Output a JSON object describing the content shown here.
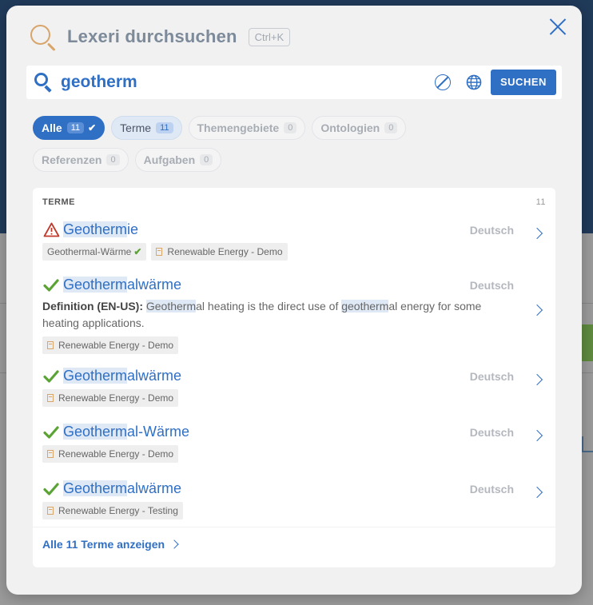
{
  "modal": {
    "title": "Lexeri durchsuchen",
    "shortcut": "Ctrl+K"
  },
  "search": {
    "query": "geotherm",
    "button_label": "SUCHEN"
  },
  "filters": [
    {
      "label": "Alle",
      "count": "11",
      "state": "active"
    },
    {
      "label": "Terme",
      "count": "11",
      "state": "selected"
    },
    {
      "label": "Themengebiete",
      "count": "0",
      "state": "default"
    },
    {
      "label": "Ontologien",
      "count": "0",
      "state": "default"
    },
    {
      "label": "Referenzen",
      "count": "0",
      "state": "default"
    },
    {
      "label": "Aufgaben",
      "count": "0",
      "state": "default"
    }
  ],
  "results": {
    "section_label": "TERME",
    "total": "11",
    "items": [
      {
        "status_icon": "warning-icon",
        "title_highlight": "Geotherm",
        "title_rest": "ie",
        "language": "Deutsch",
        "tags": [
          {
            "label": "Geothermal-Wärme",
            "icon": "check-icon"
          },
          {
            "label": "Renewable Energy - Demo",
            "icon": "document-icon"
          }
        ]
      },
      {
        "status_icon": "check-icon",
        "title_highlight": "Geotherm",
        "title_rest": "alwärme",
        "language": "Deutsch",
        "definition_label": "Definition (EN-US):",
        "definition_hl1": "Geotherm",
        "definition_mid": "al heating is the direct use of ",
        "definition_hl2": "geotherm",
        "definition_end": "al energy for some heating applications.",
        "tags": [
          {
            "label": "Renewable Energy - Demo",
            "icon": "document-icon"
          }
        ]
      },
      {
        "status_icon": "check-icon",
        "title_highlight": "Geotherm",
        "title_rest": "alwärme",
        "language": "Deutsch",
        "tags": [
          {
            "label": "Renewable Energy - Demo",
            "icon": "document-icon"
          }
        ]
      },
      {
        "status_icon": "check-icon",
        "title_highlight": "Geotherm",
        "title_rest": "al-Wärme",
        "language": "Deutsch",
        "tags": [
          {
            "label": "Renewable Energy - Demo",
            "icon": "document-icon"
          }
        ]
      },
      {
        "status_icon": "check-icon",
        "title_highlight": "Geotherm",
        "title_rest": "alwärme",
        "language": "Deutsch",
        "tags": [
          {
            "label": "Renewable Energy - Testing",
            "icon": "document-icon"
          }
        ]
      }
    ],
    "show_all_label": "Alle 11 Terme anzeigen"
  },
  "colors": {
    "accent": "#2f6fc4",
    "success": "#5ba335",
    "warning": "#c0392b",
    "highlight": "#dfe9f6"
  }
}
